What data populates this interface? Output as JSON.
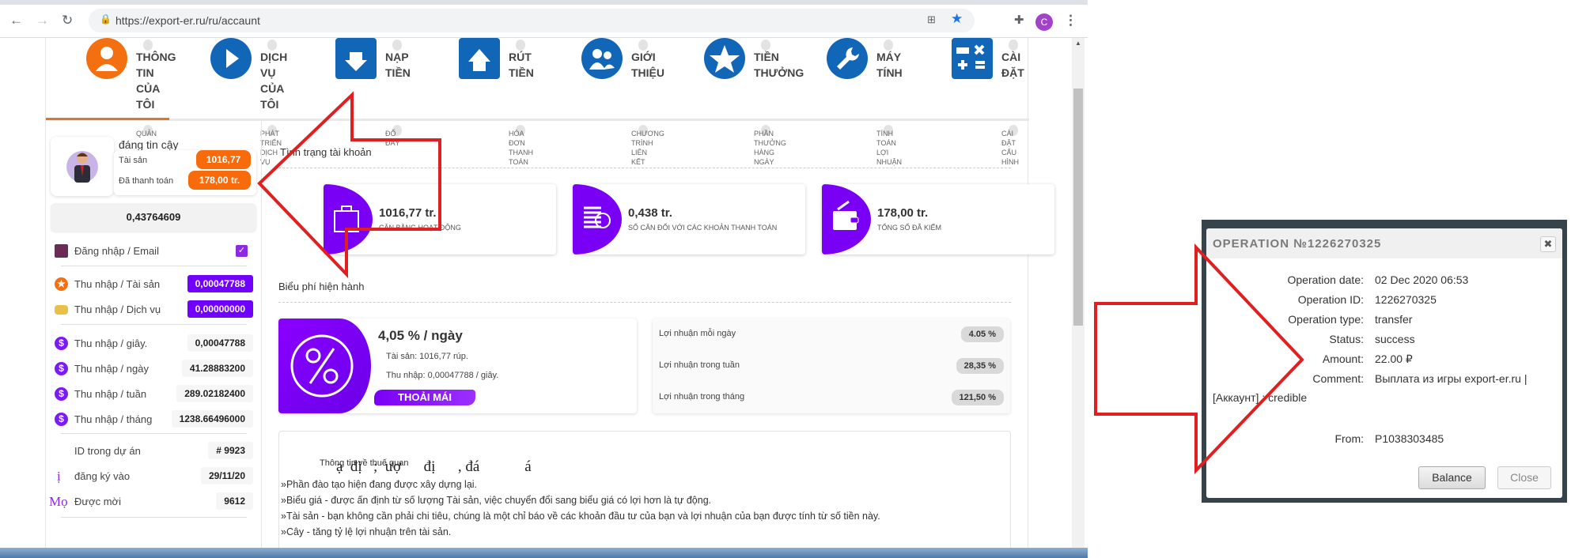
{
  "browser": {
    "url": "https://export-er.ru/ru/accaunt",
    "profile_initial": "C"
  },
  "nav": [
    {
      "label": "THÔNG TIN CỦA TÔI",
      "sub": "QUẢN",
      "color": "#f36f0f",
      "icon": "user-icon"
    },
    {
      "label": "DỊCH VỤ CỦA TÔI",
      "sub": "PHÁT TRIỂN DỊCH VỤ",
      "color": "#1266b8",
      "icon": "play-icon"
    },
    {
      "label": "NẠP TIỀN",
      "sub": "ĐỐ ĐÂY",
      "color": "#1266b8",
      "icon": "deposit-icon"
    },
    {
      "label": "RÚT TIỀN",
      "sub": "HÓA ĐƠN THANH TOÁN",
      "color": "#1266b8",
      "icon": "withdraw-icon"
    },
    {
      "label": "GIỚI THIỆU",
      "sub": "CHƯƠNG TRÌNH LIÊN KẾT",
      "color": "#1266b8",
      "icon": "referral-icon"
    },
    {
      "label": "TIỀN THƯỞNG",
      "sub": "PHẦN THƯỞNG HÀNG NGÀY",
      "color": "#1266b8",
      "icon": "star-icon"
    },
    {
      "label": "MÁY TÍNH",
      "sub": "TÍNH TOÁN LỢI NHUẬN",
      "color": "#1266b8",
      "icon": "wrench-icon"
    },
    {
      "label": "CÀI ĐẶT",
      "sub": "CÀI ĐẶT CẤU HÌNH",
      "color": "#1266b8",
      "icon": "calculator-icon"
    }
  ],
  "profile": {
    "status": "đáng tin cậy",
    "assets_label": "Tài sản",
    "assets_value": "1016,77",
    "paid_label": "Đã thanh toán",
    "paid_value": "178,00 tr.",
    "balance": "0,43764609"
  },
  "sidebar": {
    "login_label": "Đăng nhập / Email",
    "login_checked": true,
    "income_assets_label": "Thu nhập / Tài sản",
    "income_assets_value": "0,00047788",
    "income_service_label": "Thu nhập / Dịch vụ",
    "income_service_value": "0,00000000",
    "rates": [
      {
        "label": "Thu nhập / giây.",
        "value": "0,00047788"
      },
      {
        "label": "Thu nhập / ngày",
        "value": "41.28883200"
      },
      {
        "label": "Thu nhập / tuần",
        "value": "289.02182400"
      },
      {
        "label": "Thu nhập / tháng",
        "value": "1238.66496000"
      }
    ],
    "project_id_label": "ID trong dự án",
    "project_id_value": "# 9923",
    "registered_label": "đăng ký vào",
    "registered_value": "29/11/20",
    "registered_glyph": "ị",
    "invited_label": "Được mời",
    "invited_value": "9612",
    "invited_glyph": "Mọ"
  },
  "account": {
    "title": "Tình trạng tài khoản",
    "cards": [
      {
        "value": "1016,77 tr.",
        "label": "CÂN BẰNG HOẠT ĐỘNG",
        "icon": "briefcase-icon"
      },
      {
        "value": "0,438 tr.",
        "label": "SỐ CÂN ĐỐI VỚI CÁC KHOẢN THANH TOÁN",
        "icon": "coins-icon"
      },
      {
        "value": "178,00 tr.",
        "label": "TỔNG SỐ ĐÃ KIẾM",
        "icon": "wallet-icon"
      }
    ]
  },
  "tariff": {
    "title": "Biểu phí hiện hành",
    "rate": "4,05 % / ngày",
    "assets": "Tài sản: 1016,77 rúp.",
    "income": "Thu nhập: 0,00047788 / giây.",
    "plan": "THOẢI MÁI",
    "profits": [
      {
        "label": "Lợi nhuận mỗi ngày",
        "value": "4.05 %"
      },
      {
        "label": "Lợi nhuận trong tuần",
        "value": "28,35 %"
      },
      {
        "label": "Lợi nhuận trong tháng",
        "value": "121,50 %"
      }
    ]
  },
  "info": {
    "title": "Thông tin về thuế quan",
    "garbled": "ạ  đị   ;  ượ      đị      , đá            á",
    "lines": [
      "»Phần đào tạo hiện đang được xây dựng lại.",
      "»Biểu giá - được ấn định từ số lượng Tài sản, việc chuyển đổi sang biểu giá có lợi hơn là tự động.",
      "»Tài sản - bạn không cần phải chi tiêu, chúng là một chỉ báo về các khoản đầu tư của bạn và lợi nhuận của bạn được tính từ số tiền này.",
      "»Cây - tăng tỷ lệ lợi nhuận trên tài sản."
    ]
  },
  "modal": {
    "title": "OPERATION №1226270325",
    "rows": [
      {
        "label": "Operation date:",
        "value": "02 Dec 2020 06:53"
      },
      {
        "label": "Operation ID:",
        "value": "1226270325"
      },
      {
        "label": "Operation type:",
        "value": "transfer"
      },
      {
        "label": "Status:",
        "value": "success"
      },
      {
        "label": "Amount:",
        "value": "22.00 ₽"
      },
      {
        "label": "Comment:",
        "value": "Выплата из игры export-er.ru |"
      }
    ],
    "comment_cont": "[Аккаунт] : credible",
    "from_label": "From:",
    "from_value": "P1038303485",
    "balance_btn": "Balance",
    "close_btn": "Close"
  },
  "colors": {
    "accent_purple": "#7a00f5",
    "accent_orange": "#f76b0b",
    "annotation_red": "#e02020"
  }
}
